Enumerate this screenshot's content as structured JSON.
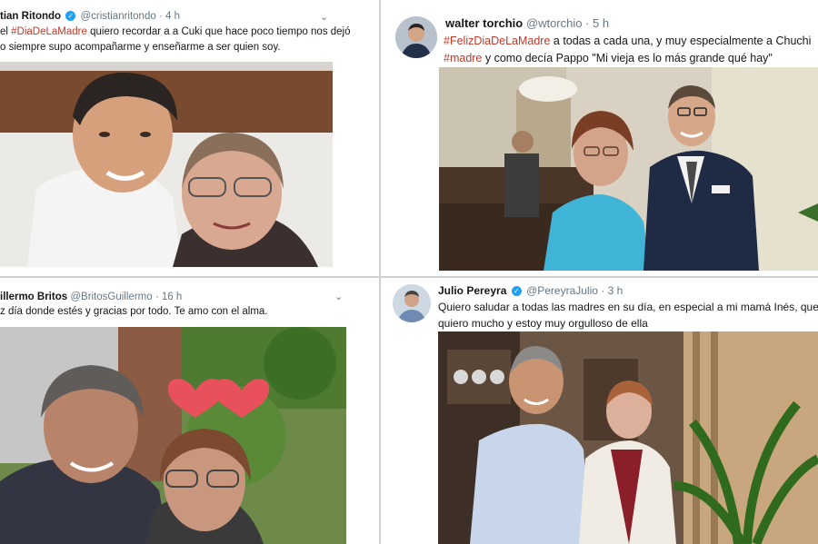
{
  "tweets": [
    {
      "name": "tian Ritondo",
      "handle": "@cristianritondo",
      "time": "· 4 h",
      "line1_pre": "el ",
      "line1_hashtag": "#DiaDeLaMadre",
      "line1_post": " quiero recordar a a Cuki que hace poco tiempo nos dejó",
      "line2": "o siempre supo acompañarme y enseñarme a ser quien soy."
    },
    {
      "name": "walter torchio",
      "handle": "@wtorchio",
      "time": "· 5 h",
      "line1_hashtag": "#FelizDiaDeLaMadre",
      "line1_post": " a todas a cada una, y muy especialmente a Chuchi",
      "line2_hashtag": "#madre",
      "line2_post": " y como decía Pappo \"Mi vieja es lo más grande qué hay\""
    },
    {
      "name": "illermo Britos",
      "handle": "@BritosGuillermo",
      "time": "· 16 h",
      "line1": "z día donde estés y gracias por todo. Te amo con el alma."
    },
    {
      "name": "Julio Pereyra",
      "handle": "@PereyraJulio",
      "time": "· 3 h",
      "line1": "Quiero saludar a todas las madres en su día, en especial a mi mamá Inés, que",
      "line2": "quiero mucho y estoy muy orgulloso de ella"
    }
  ],
  "icons": {
    "chevron": "chevron-down-icon",
    "verified": "verified-badge-icon"
  },
  "colors": {
    "hashtag": "#c0392b",
    "verified": "#1da1f2",
    "meta": "#657786"
  }
}
